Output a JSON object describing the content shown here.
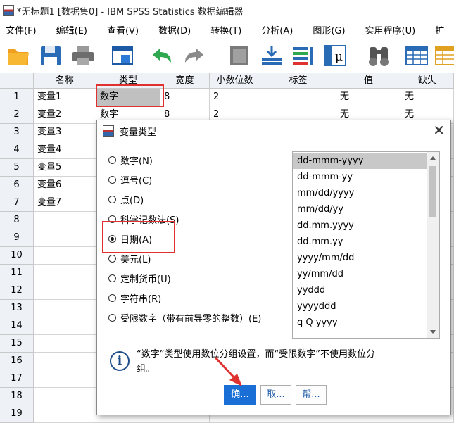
{
  "window": {
    "title": "*无标题1 [数据集0] - IBM SPSS Statistics 数据编辑器"
  },
  "menu": [
    "文件(F)",
    "编辑(E)",
    "查看(V)",
    "数据(D)",
    "转换(T)",
    "分析(A)",
    "图形(G)",
    "实用程序(U)",
    "扩"
  ],
  "toolbar_icons": [
    "open-folder-icon",
    "save-icon",
    "print-icon",
    "dialog-recall-icon",
    "undo-icon",
    "redo-icon",
    "goto-case-icon",
    "goto-variable-icon",
    "variables-icon",
    "value-labels-icon",
    "find-icon",
    "insert-cases-icon",
    "insert-variable-icon"
  ],
  "grid": {
    "headers": [
      "名称",
      "类型",
      "宽度",
      "小数位数",
      "标签",
      "值",
      "缺失"
    ],
    "rows": [
      {
        "num": "1",
        "name": "变量1",
        "type": "数字",
        "width": "8",
        "dec": "2",
        "value": "无",
        "missing": "无"
      },
      {
        "num": "2",
        "name": "变量2",
        "type": "数字",
        "width": "8",
        "dec": "2",
        "value": "无",
        "missing": "无"
      },
      {
        "num": "3",
        "name": "变量3"
      },
      {
        "num": "4",
        "name": "变量4"
      },
      {
        "num": "5",
        "name": "变量5"
      },
      {
        "num": "6",
        "name": "变量6"
      },
      {
        "num": "7",
        "name": "变量7"
      },
      {
        "num": "8"
      },
      {
        "num": "9"
      },
      {
        "num": "10"
      },
      {
        "num": "11"
      },
      {
        "num": "12"
      },
      {
        "num": "13"
      },
      {
        "num": "14"
      },
      {
        "num": "15"
      },
      {
        "num": "16"
      },
      {
        "num": "17"
      },
      {
        "num": "18"
      },
      {
        "num": "19"
      }
    ]
  },
  "dialog": {
    "title": "变量类型",
    "close": "✕",
    "radios": [
      "数字(N)",
      "逗号(C)",
      "点(D)",
      "科学记数法(S)",
      "日期(A)",
      "美元(L)",
      "定制货币(U)",
      "字符串(R)",
      "受限数字（带有前导零的整数）(E)"
    ],
    "selected_index": 4,
    "formats": [
      "dd-mmm-yyyy",
      "dd-mmm-yy",
      "mm/dd/yyyy",
      "mm/dd/yy",
      "dd.mm.yyyy",
      "dd.mm.yy",
      "yyyy/mm/dd",
      "yy/mm/dd",
      "yyddd",
      "yyyyddd",
      "q Q yyyy"
    ],
    "selected_format": "dd-mmm-yyyy",
    "info_line1": "“数字”类型使用数位分组设置，而“受限数字”不使用数位分",
    "info_line2": "组。",
    "buttons": {
      "ok": "确...",
      "cancel": "取...",
      "help": "帮..."
    }
  },
  "colors": {
    "accent": "#1a6fd6",
    "highlight": "#e03131",
    "selected_cell": "#c0c0c0"
  }
}
